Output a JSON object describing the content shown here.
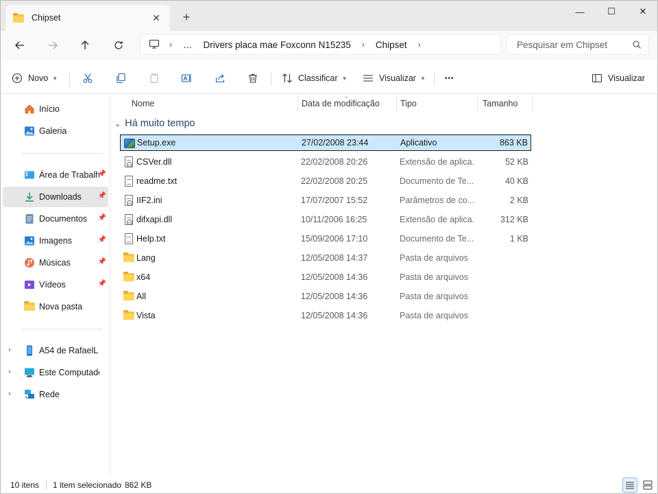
{
  "tab": {
    "title": "Chipset",
    "close": "✕",
    "new": "+"
  },
  "window_controls": {
    "minimize": "—",
    "maximize": "☐",
    "close": "✕"
  },
  "address": {
    "segments": [
      "…",
      "Drivers placa mae Foxconn N15235",
      "Chipset"
    ]
  },
  "search": {
    "placeholder": "Pesquisar em Chipset"
  },
  "toolbar": {
    "new_label": "Novo",
    "sort_label": "Classificar",
    "view_label": "Visualizar",
    "more_label": "•••",
    "details_label": "Visualizar"
  },
  "sidebar": {
    "items": [
      {
        "label": "Início",
        "icon": "home-icon"
      },
      {
        "label": "Galeria",
        "icon": "gallery-icon"
      },
      {
        "label": "Área de Trabalho",
        "icon": "desktop-icon",
        "pinned": true
      },
      {
        "label": "Downloads",
        "icon": "download-icon",
        "pinned": true,
        "active": true
      },
      {
        "label": "Documentos",
        "icon": "documents-icon",
        "pinned": true
      },
      {
        "label": "Imagens",
        "icon": "pictures-icon",
        "pinned": true
      },
      {
        "label": "Músicas",
        "icon": "music-icon",
        "pinned": true
      },
      {
        "label": "Vídeos",
        "icon": "videos-icon",
        "pinned": true
      },
      {
        "label": "Nova pasta",
        "icon": "folder-icon"
      },
      {
        "label": "A54 de RafaelL",
        "icon": "phone-icon",
        "expandable": true
      },
      {
        "label": "Este Computador",
        "icon": "computer-icon",
        "expandable": true
      },
      {
        "label": "Rede",
        "icon": "network-icon",
        "expandable": true
      }
    ]
  },
  "columns": {
    "name": "Nome",
    "date": "Data de modificação",
    "type": "Tipo",
    "size": "Tamanho"
  },
  "group": {
    "title": "Há muito tempo"
  },
  "files": [
    {
      "name": "Setup.exe",
      "date": "27/02/2008 23:44",
      "type": "Aplicativo",
      "size": "863 KB",
      "kind": "exe",
      "selected": true
    },
    {
      "name": "CSVer.dll",
      "date": "22/02/2008 20:26",
      "type": "Extensão de aplica...",
      "size": "52 KB",
      "kind": "dll"
    },
    {
      "name": "readme.txt",
      "date": "22/02/2008 20:25",
      "type": "Documento de Te...",
      "size": "40 KB",
      "kind": "txt"
    },
    {
      "name": "IIF2.ini",
      "date": "17/07/2007 15:52",
      "type": "Parâmetros de co...",
      "size": "2 KB",
      "kind": "ini"
    },
    {
      "name": "difxapi.dll",
      "date": "10/11/2006 16:25",
      "type": "Extensão de aplica...",
      "size": "312 KB",
      "kind": "dll"
    },
    {
      "name": "Help.txt",
      "date": "15/09/2006 17:10",
      "type": "Documento de Te...",
      "size": "1 KB",
      "kind": "txt"
    },
    {
      "name": "Lang",
      "date": "12/05/2008 14:37",
      "type": "Pasta de arquivos",
      "size": "",
      "kind": "folder"
    },
    {
      "name": "x64",
      "date": "12/05/2008 14:36",
      "type": "Pasta de arquivos",
      "size": "",
      "kind": "folder"
    },
    {
      "name": "All",
      "date": "12/05/2008 14:36",
      "type": "Pasta de arquivos",
      "size": "",
      "kind": "folder"
    },
    {
      "name": "Vista",
      "date": "12/05/2008 14:36",
      "type": "Pasta de arquivos",
      "size": "",
      "kind": "folder"
    }
  ],
  "status": {
    "count": "10 itens",
    "selection": "1 item selecionado",
    "selection_size": "862 KB"
  },
  "colors": {
    "selection_bg": "#cce8ff",
    "accent": "#0067c0",
    "group_header": "#2a3f6b"
  }
}
